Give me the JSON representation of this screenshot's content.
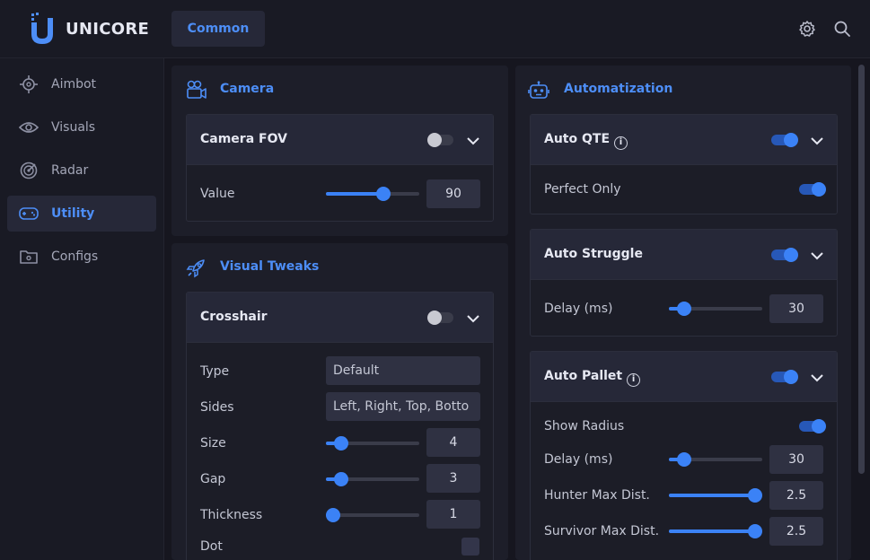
{
  "app": {
    "brand": "UNICORE",
    "accent": "#4d8ef7"
  },
  "header": {
    "tab_common": "Common",
    "icons": [
      "gear-icon",
      "search-icon"
    ]
  },
  "sidebar": {
    "items": [
      {
        "label": "Aimbot",
        "icon": "crosshair-icon",
        "active": false
      },
      {
        "label": "Visuals",
        "icon": "eye-icon",
        "active": false
      },
      {
        "label": "Radar",
        "icon": "radar-icon",
        "active": false
      },
      {
        "label": "Utility",
        "icon": "gamepad-icon",
        "active": true
      },
      {
        "label": "Configs",
        "icon": "folder-icon",
        "active": false
      }
    ]
  },
  "camera": {
    "title": "Camera",
    "fov": {
      "title": "Camera FOV",
      "enabled": false,
      "value_label": "Value",
      "value": "90",
      "slider_fraction": 0.62
    }
  },
  "visual_tweaks": {
    "title": "Visual Tweaks",
    "crosshair": {
      "title": "Crosshair",
      "enabled": false,
      "type_label": "Type",
      "type_value": "Default",
      "sides_label": "Sides",
      "sides_value": "Left, Right, Top, Botto",
      "size_label": "Size",
      "size_value": "4",
      "size_fraction": 0.16,
      "gap_label": "Gap",
      "gap_value": "3",
      "gap_fraction": 0.16,
      "thickness_label": "Thickness",
      "thickness_value": "1",
      "thickness_fraction": 0.08,
      "dot_label": "Dot",
      "dot_checked": false
    }
  },
  "automatization": {
    "title": "Automatization",
    "auto_qte": {
      "title": "Auto QTE",
      "enabled": true,
      "perfect_only_label": "Perfect Only",
      "perfect_only": true
    },
    "auto_struggle": {
      "title": "Auto Struggle",
      "enabled": true,
      "delay_label": "Delay (ms)",
      "delay_value": "30",
      "delay_fraction": 0.16
    },
    "auto_pallet": {
      "title": "Auto Pallet",
      "enabled": true,
      "show_radius_label": "Show Radius",
      "show_radius": true,
      "delay_label": "Delay (ms)",
      "delay_value": "30",
      "delay_fraction": 0.16,
      "hunter_label": "Hunter Max Dist.",
      "hunter_value": "2.5",
      "hunter_fraction": 0.92,
      "survivor_label": "Survivor Max Dist.",
      "survivor_value": "2.5",
      "survivor_fraction": 0.92
    }
  }
}
